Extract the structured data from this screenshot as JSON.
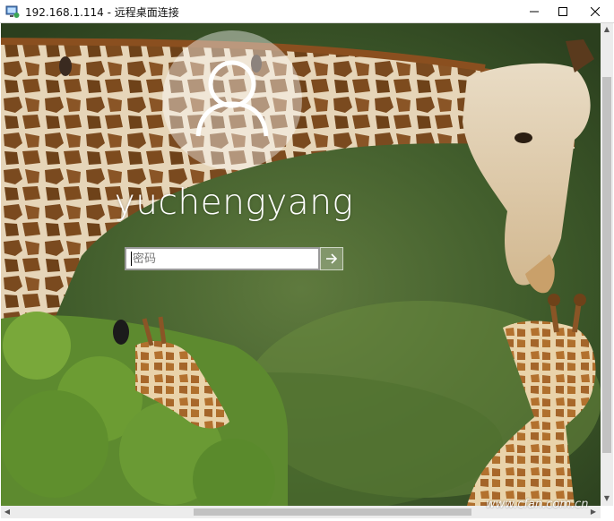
{
  "window": {
    "title": "192.168.1.114 - 远程桌面连接",
    "icons": [
      "remote-desktop-icon",
      "minimize-icon",
      "maximize-icon",
      "close-icon"
    ]
  },
  "login": {
    "username": "yuchengyang",
    "password_placeholder": "密码",
    "submit_icon": "arrow-right-icon",
    "avatar_icon": "user-silhouette-icon"
  },
  "background": {
    "subject": "giraffes",
    "sky_color": "#3f5a2c",
    "accent": "#b37a3c"
  },
  "watermark": "www.cfan.com.cn"
}
